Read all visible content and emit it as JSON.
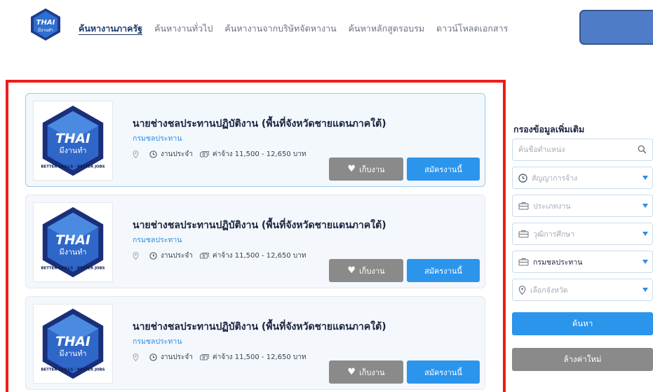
{
  "header": {
    "logo": {
      "line1": "THAI",
      "line2": "มีงานทำ"
    },
    "nav": [
      "ค้นหางานภาครัฐ",
      "ค้นหางานทั่วไป",
      "ค้นหางานจากบริษัทจัดหางาน",
      "ค้นหาหลักสูตรอบรม",
      "ดาวน์โหลดเอกสาร"
    ]
  },
  "jobs": [
    {
      "title": "นายช่างชลประทานปฏิบัติงาน (พื้นที่จังหวัดชายแดนภาคใต้)",
      "department": "กรมชลประทาน",
      "logo": {
        "line1": "THAI",
        "line2": "มีงานทำ",
        "ring": "BETTER SKILLS · BETTER JOBS"
      },
      "job_type": "งานประจำ",
      "salary": "ค่าจ้าง 11,500 - 12,650 บาท",
      "save_label": "เก็บงาน",
      "apply_label": "สมัครงานนี้"
    },
    {
      "title": "นายช่างชลประทานปฏิบัติงาน (พื้นที่จังหวัดชายแดนภาคใต้)",
      "department": "กรมชลประทาน",
      "logo": {
        "line1": "THAI",
        "line2": "มีงานทำ",
        "ring": "BETTER SKILLS · BETTER JOBS"
      },
      "job_type": "งานประจำ",
      "salary": "ค่าจ้าง 11,500 - 12,650 บาท",
      "save_label": "เก็บงาน",
      "apply_label": "สมัครงานนี้"
    },
    {
      "title": "นายช่างชลประทานปฏิบัติงาน (พื้นที่จังหวัดชายแดนภาคใต้)",
      "department": "กรมชลประทาน",
      "logo": {
        "line1": "THAI",
        "line2": "มีงานทำ",
        "ring": "BETTER SKILLS · BETTER JOBS"
      },
      "job_type": "งานประจำ",
      "salary": "ค่าจ้าง 11,500 - 12,650 บาท",
      "save_label": "เก็บงาน",
      "apply_label": "สมัครงานนี้"
    }
  ],
  "filter": {
    "title": "กรองข้อมูลเพิ่มเติม",
    "position_placeholder": "ค้นชื่อตำแหน่ง",
    "contract_type": "สัญญาการจ้าง",
    "job_category": "ประเภทงาน",
    "education": "วุฒิการศึกษา",
    "department": "กรมชลประทาน",
    "province": "เลือกจังหวัด",
    "search_label": "ค้นหา",
    "reset_label": "ล้างค่าใหม่"
  },
  "colors": {
    "primary_blue": "#2b95ec",
    "save_gray": "#8a8a8a",
    "highlight_red": "#ee1c1c",
    "navy": "#1e3a6d"
  }
}
